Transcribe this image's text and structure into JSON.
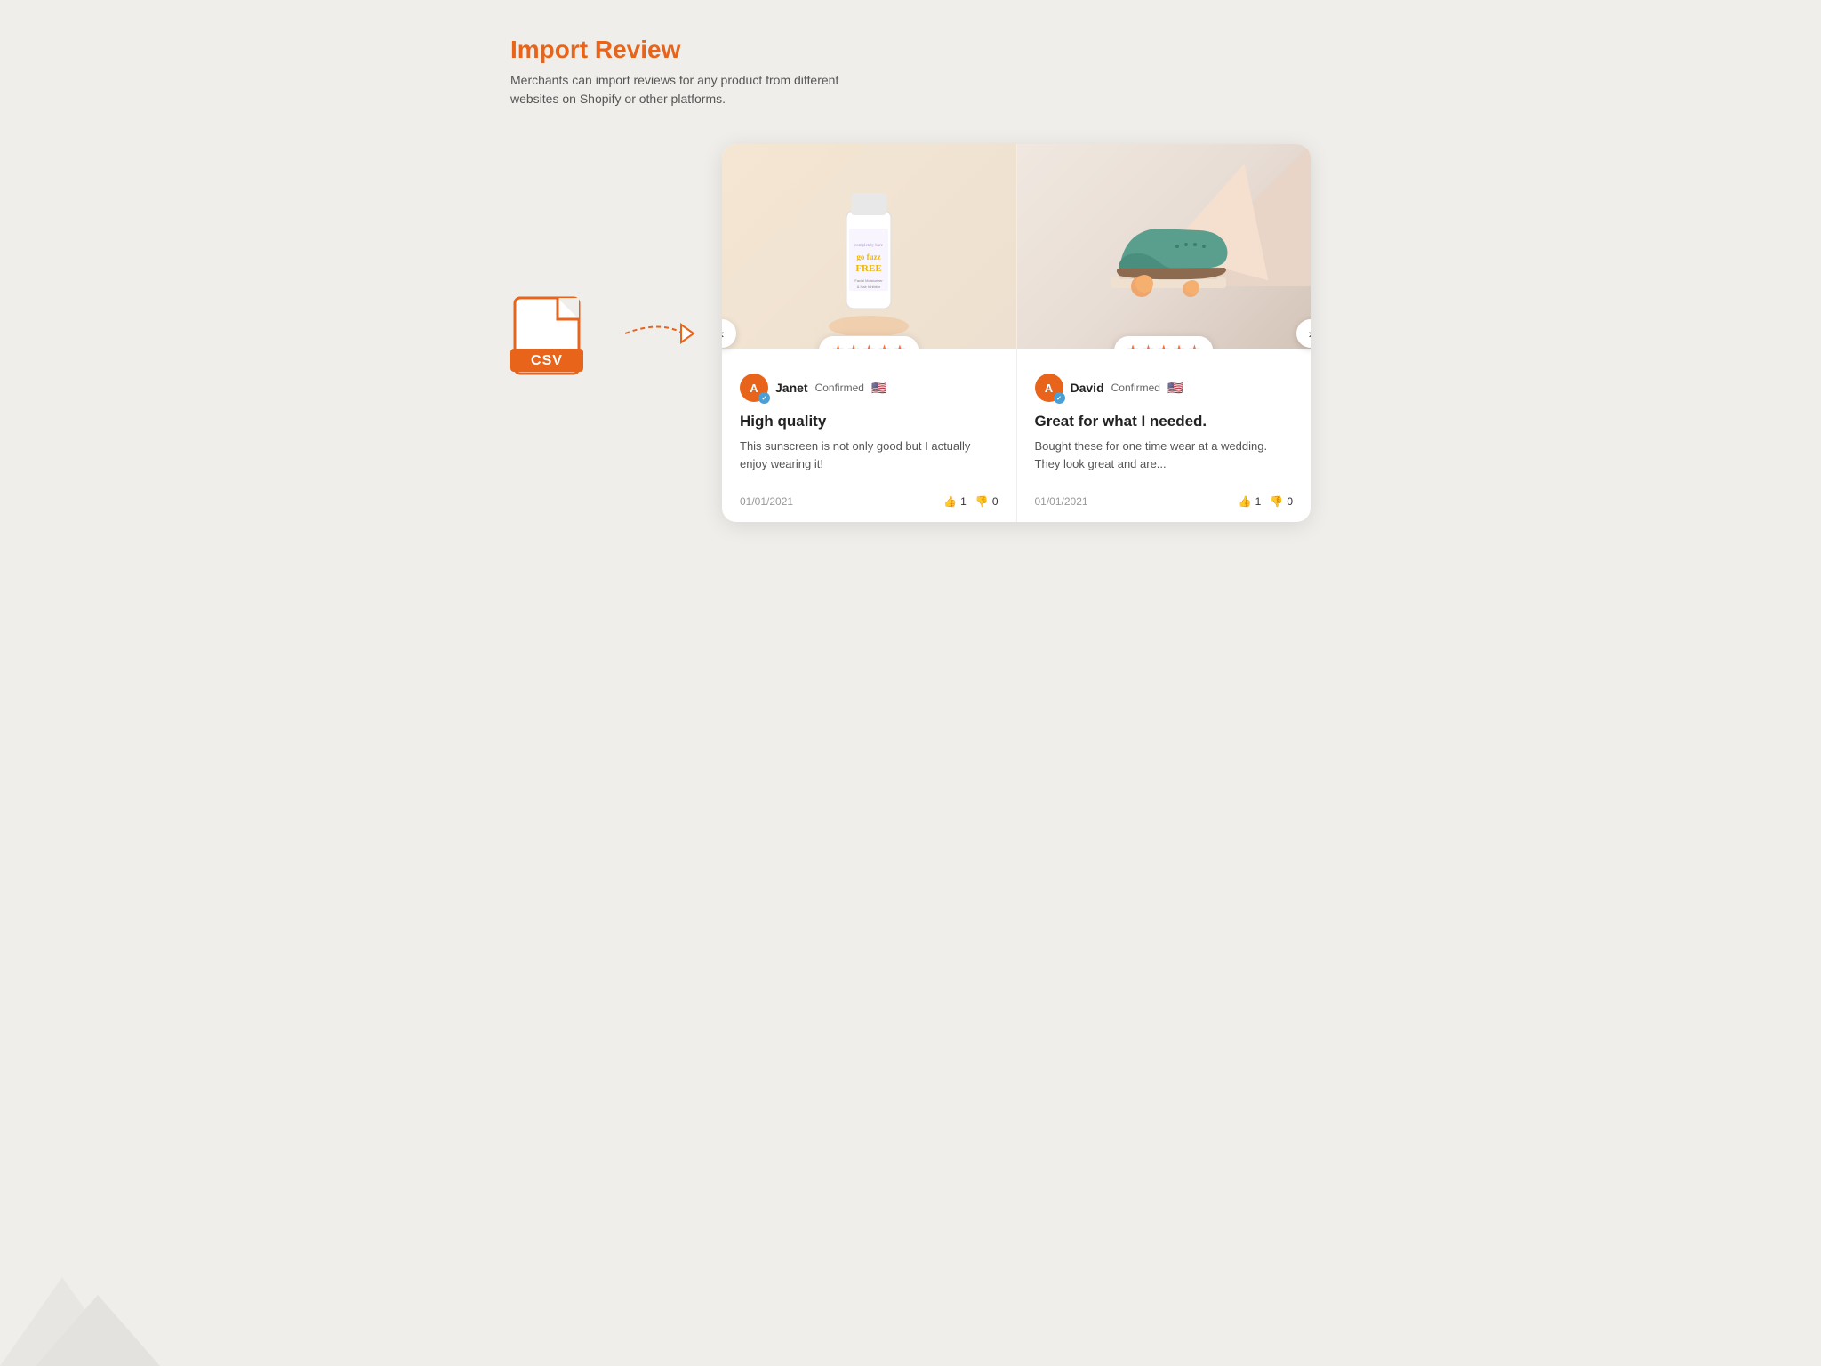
{
  "header": {
    "title": "Import Review",
    "subtitle": "Merchants can import reviews for any product from different websites on Shopify or other platforms."
  },
  "csv_icon": {
    "label": "CSV"
  },
  "cards": [
    {
      "id": "card-1",
      "product_type": "skincare",
      "rating": 5,
      "stars": [
        "★",
        "★",
        "★",
        "★",
        "★"
      ],
      "reviewer_initial": "A",
      "reviewer_name": "Janet",
      "confirmed_text": "Confirmed",
      "flag": "🇺🇸",
      "review_title": "High quality",
      "review_text": "This sunscreen is not only good but I actually enjoy wearing it!",
      "date": "01/01/2021",
      "thumbs_up": 1,
      "thumbs_down": 0,
      "nav_prev": "‹",
      "nav_next": "›"
    },
    {
      "id": "card-2",
      "product_type": "shoe",
      "rating": 5,
      "stars": [
        "★",
        "★",
        "★",
        "★",
        "★"
      ],
      "reviewer_initial": "A",
      "reviewer_name": "David",
      "confirmed_text": "Confirmed",
      "flag": "🇺🇸",
      "review_title": "Great for what I needed.",
      "review_text": "Bought these for one time wear at a wedding. They look great and are...",
      "date": "01/01/2021",
      "thumbs_up": 1,
      "thumbs_down": 0
    }
  ],
  "colors": {
    "orange": "#e8641a",
    "blue_check": "#4a9fd4"
  }
}
